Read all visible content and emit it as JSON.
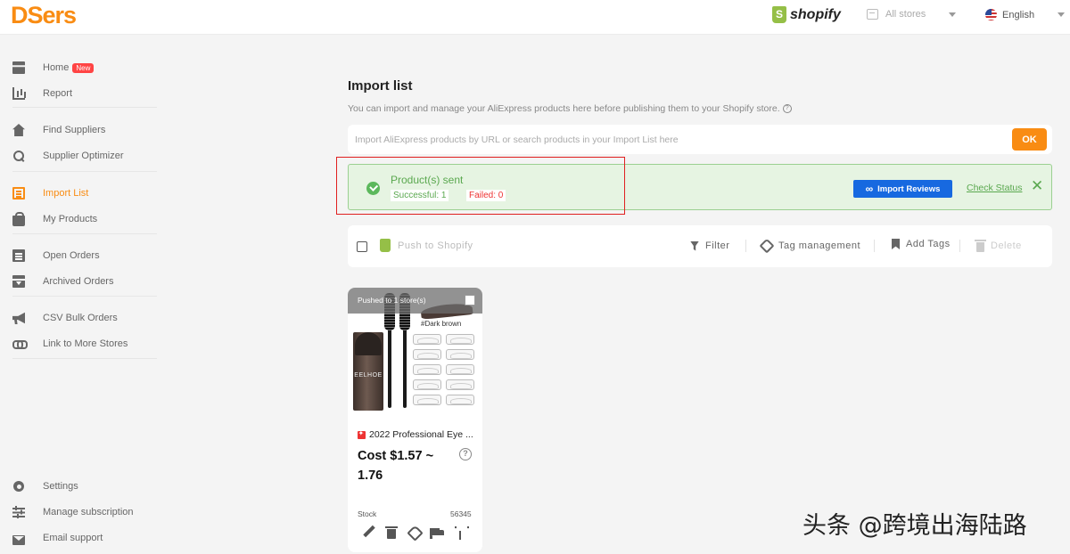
{
  "header": {
    "logo": "DSers",
    "platform": "shopify",
    "stores_label": "All stores",
    "language": "English"
  },
  "sidebar": {
    "items": [
      {
        "label": "Home",
        "icon": "dashboard-icon",
        "badge": "New"
      },
      {
        "label": "Report",
        "icon": "bar-chart-icon"
      },
      {
        "label": "Find Suppliers",
        "icon": "home-icon"
      },
      {
        "label": "Supplier Optimizer",
        "icon": "search-icon"
      },
      {
        "label": "Import List",
        "icon": "list-icon",
        "active": true
      },
      {
        "label": "My Products",
        "icon": "shopping-bag-icon"
      },
      {
        "label": "Open Orders",
        "icon": "clipboard-icon"
      },
      {
        "label": "Archived Orders",
        "icon": "archive-icon"
      },
      {
        "label": "CSV Bulk Orders",
        "icon": "megaphone-icon"
      },
      {
        "label": "Link to More Stores",
        "icon": "link-icon"
      },
      {
        "label": "Settings",
        "icon": "gear-icon"
      },
      {
        "label": "Manage subscription",
        "icon": "sliders-icon"
      },
      {
        "label": "Email support",
        "icon": "mail-icon"
      }
    ]
  },
  "main": {
    "title": "Import list",
    "description": "You can import and manage your AliExpress products here before publishing them to your Shopify store.",
    "search_placeholder": "Import AliExpress products by URL or search products in your Import List here",
    "ok_label": "OK"
  },
  "alert": {
    "title": "Product(s) sent",
    "successful": "Successful: 1",
    "failed": "Failed: 0",
    "import_reviews": "Import Reviews",
    "check_status": "Check Status",
    "accent_color": "#5aa84f"
  },
  "toolbar": {
    "push": "Push to Shopify",
    "filter": "Filter",
    "tag_management": "Tag management",
    "add_tags": "Add Tags",
    "delete": "Delete"
  },
  "product": {
    "pushed": "Pushed to 1 store(s)",
    "variant_label": "#Dark brown",
    "brand": "EELHOE",
    "title": "2022 Professional Eye ...",
    "cost": "Cost $1.57 ~ 1.76",
    "stock_label": "Stock",
    "stock_value": "56345"
  },
  "watermark": "头条 @跨境出海陆路",
  "colors": {
    "brand_orange": "#f98c13",
    "shopify_green": "#95bf47",
    "primary_blue": "#1769e0",
    "highlight_red": "#e02020"
  }
}
